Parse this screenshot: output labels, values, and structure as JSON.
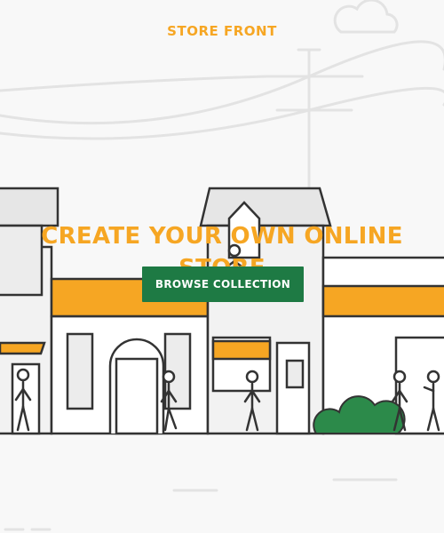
{
  "header": {
    "brand": "STORE FRONT"
  },
  "hero": {
    "headline": "CREATE YOUR OWN ONLINE STORE",
    "cta_label": "BROWSE COLLECTION"
  },
  "colors": {
    "accent": "#f6a623",
    "cta_background": "#1e7a44",
    "outline": "#333333",
    "background": "#f8f8f8"
  }
}
